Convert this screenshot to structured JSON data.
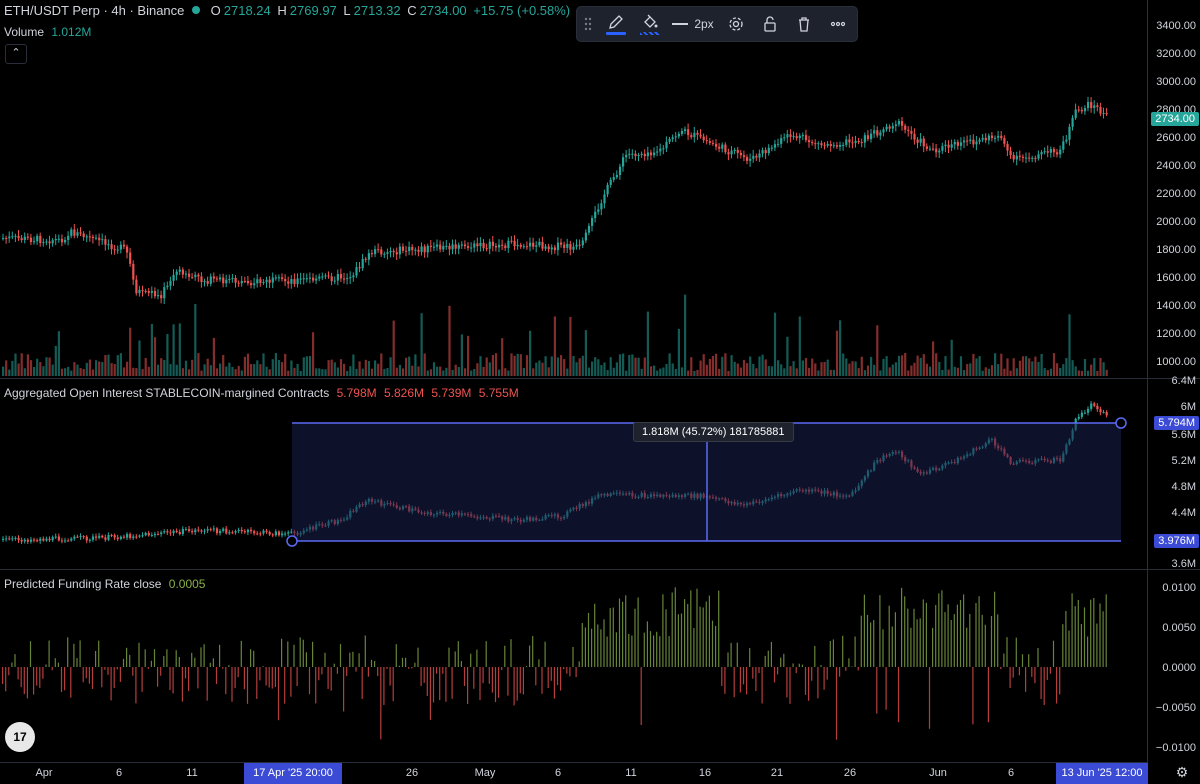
{
  "symbol": {
    "title": "ETH/USDT Perp · 4h · Binance",
    "status_color": "#26a69a"
  },
  "ohlc": {
    "o_label": "O",
    "o": "2718.24",
    "h_label": "H",
    "h": "2769.97",
    "l_label": "L",
    "l": "2713.32",
    "c_label": "C",
    "c": "2734.00",
    "change": "+15.75 (+0.58%)"
  },
  "volume": {
    "label": "Volume",
    "value": "1.012M"
  },
  "collapse_glyph": "⌃",
  "toolbar": {
    "icons": [
      "drag-handle",
      "pencil-icon",
      "fill-bucket-icon",
      "line-width-icon",
      "settings-icon",
      "unlock-icon",
      "trash-icon",
      "more-icon"
    ],
    "line_width_label": "2px",
    "accent": "#2962ff"
  },
  "price_axis": {
    "labels": [
      "3400.00",
      "3200.00",
      "3000.00",
      "2800.00",
      "2600.00",
      "2400.00",
      "2200.00",
      "2000.00",
      "1800.00",
      "1600.00",
      "1400.00",
      "1200.00",
      "1000.00"
    ],
    "current": "2734.00",
    "current_color": "#26a69a"
  },
  "oi": {
    "title": "Aggregated Open Interest STABLECOIN-margined Contracts",
    "o": "5.798M",
    "h": "5.826M",
    "l": "5.739M",
    "c": "5.755M",
    "axis_labels": [
      "6.4M",
      "6M",
      "5.6M",
      "5.2M",
      "4.8M",
      "4.4M",
      "3.6M"
    ],
    "upper_tag": "5.794M",
    "lower_tag": "3.976M",
    "measure_label": "1.818M (45.72%) 181785881",
    "range_color": "#5b6bf5"
  },
  "funding": {
    "title": "Predicted Funding Rate close",
    "value": "0.0005",
    "axis_labels": [
      "0.0100",
      "0.0050",
      "0.0000",
      "−0.0050",
      "−0.0100"
    ]
  },
  "time_axis": {
    "labels": [
      {
        "text": "Apr"
      },
      {
        "text": "6"
      },
      {
        "text": "11"
      },
      {
        "text": "26"
      },
      {
        "text": "May"
      },
      {
        "text": "6"
      },
      {
        "text": "11"
      },
      {
        "text": "16"
      },
      {
        "text": "21"
      },
      {
        "text": "26"
      },
      {
        "text": "Jun"
      },
      {
        "text": "6"
      }
    ],
    "highlight_start": "17 Apr '25   20:00",
    "highlight_end": "13 Jun '25   12:00"
  },
  "logo_text": "17",
  "colors": {
    "up": "#26a69a",
    "down": "#ef5350",
    "bg": "#000000",
    "funding_up": "#89b04a",
    "funding_down": "#ef5350"
  }
}
